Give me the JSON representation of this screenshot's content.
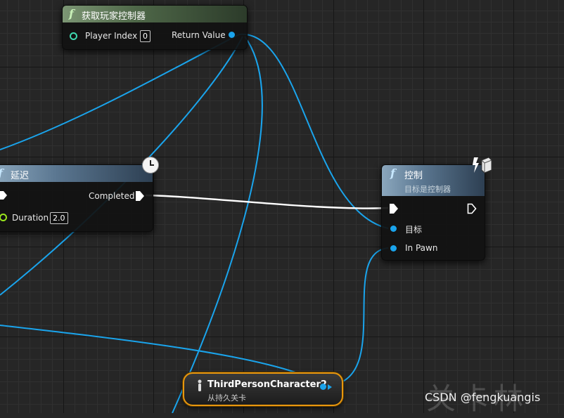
{
  "get_controller_node": {
    "icon": "function-icon",
    "title": "获取玩家控制器",
    "input_label": "Player Index",
    "input_value": "0",
    "output_label": "Return Value"
  },
  "delay_node": {
    "icon": "function-icon",
    "title": "延迟",
    "output_label": "Completed",
    "input_label": "Duration",
    "input_value": "2.0"
  },
  "possess_node": {
    "icon": "function-icon",
    "title": "控制",
    "subtitle": "目标是控制器",
    "target_label": "目标",
    "pawn_label": "In Pawn"
  },
  "variable_node": {
    "title": "ThirdPersonCharacter2",
    "subtitle": "从持久关卡"
  },
  "watermark": {
    "text": "CSDN @fengkuangis",
    "big_text": "关卡林"
  },
  "colors": {
    "object_wire": "#1aa4ec",
    "exec_wire": "#ffffff",
    "variable_border": "#e8970e"
  }
}
